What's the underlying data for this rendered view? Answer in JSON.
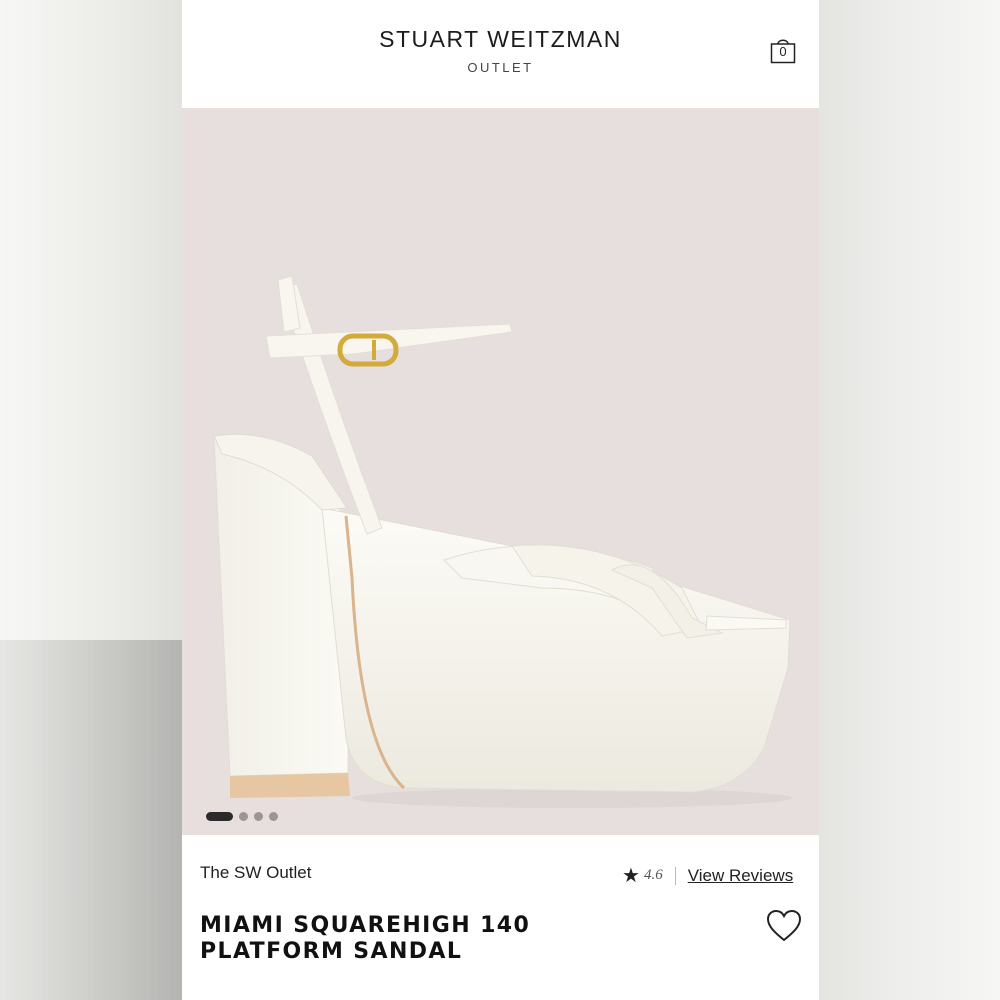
{
  "header": {
    "brand": "STUART WEITZMAN",
    "subtitle": "OUTLET",
    "bag_count": "0",
    "bag_icon": "shopping-bag-icon"
  },
  "carousel": {
    "image": "white-platform-sandal",
    "background_color": "#e6dfde",
    "slide_count": 4,
    "active_slide": 1
  },
  "product": {
    "store": "The SW Outlet",
    "rating": "4.6",
    "reviews_link": "View Reviews",
    "title_line1": "MIAMI SQUAREHIGH 140",
    "title_line2": "PLATFORM SANDAL",
    "favorite_icon": "heart-icon"
  }
}
